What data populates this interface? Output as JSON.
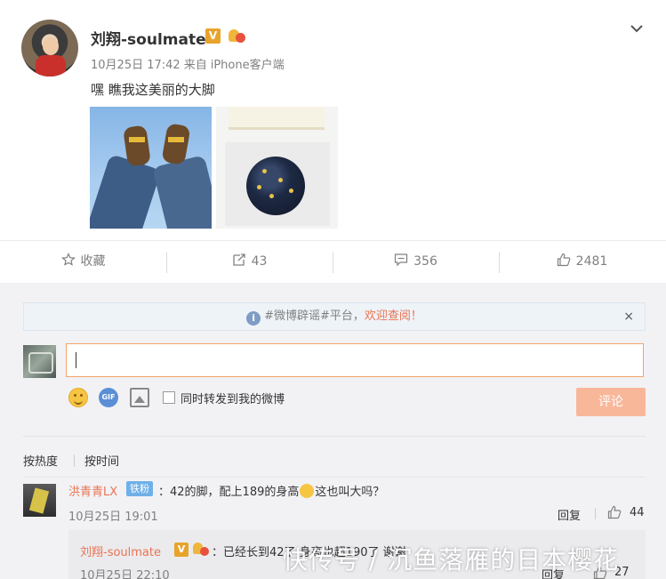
{
  "post": {
    "username": "刘翔-soulmate",
    "verified_badge": "V",
    "date": "10月25日 17:42",
    "source_prefix": "来自",
    "source": "iPhone客户端",
    "text": "嘿 瞧我这美丽的大脚",
    "images": [
      "feet-photo",
      "cake-photo"
    ]
  },
  "actions": {
    "favorite_label": "收藏",
    "repost_count": "43",
    "comment_count": "356",
    "like_count": "2481"
  },
  "notice": {
    "info_glyph": "i",
    "prefix": "#微博辟谣#平台，",
    "highlight": "欢迎查阅！",
    "close": "×"
  },
  "composer": {
    "input_value": "",
    "gif_label": "GIF",
    "repost_label": "同时转发到我的微博",
    "submit_label": "评论"
  },
  "sort": {
    "by_heat": "按热度",
    "by_time": "按时间"
  },
  "comments": [
    {
      "user": "洪青青LX",
      "badge": "铁粉",
      "text_before": "：42的脚，配上189的身高",
      "text_after": "这也叫大吗？",
      "time": "10月25日 19:01",
      "reply_label": "回复",
      "likes": "44",
      "reply": {
        "user": "刘翔-soulmate",
        "verified_badge": "V",
        "text": "：已经长到42了 身高也超190了 谢谢",
        "time": "10月25日 22:10",
        "reply_label": "回复",
        "likes": "27"
      }
    }
  ],
  "watermark": "快传号 / 沉鱼落雁的日本樱花",
  "colors": {
    "accent": "#eb7350",
    "submit_disabled": "#f9b79a",
    "verified": "#e8a32b",
    "fan_badge": "#6fb0e8"
  },
  "icons": {
    "favorite": "star-icon",
    "repost": "repost-icon",
    "comment": "comment-icon",
    "like": "thumbs-up-icon",
    "dropdown": "chevron-down-icon",
    "info": "info-icon",
    "emoji": "emoji-icon",
    "gif": "gif-icon",
    "image": "image-icon"
  }
}
